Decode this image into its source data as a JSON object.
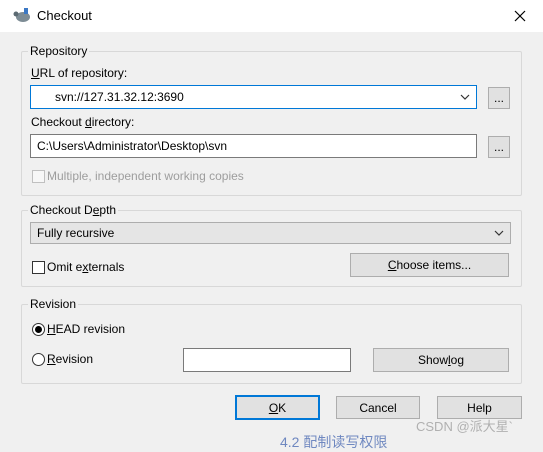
{
  "window": {
    "title": "Checkout",
    "close_icon": "close-icon",
    "app_icon": "svn-turtle-icon"
  },
  "repository": {
    "group_label": "Repository",
    "url_label": "URL of repository:",
    "url_value": "svn://127.31.32.12:3690",
    "browse_label": "...",
    "dir_label": "Checkout directory:",
    "dir_value": "C:\\Users\\Administrator\\Desktop\\svn",
    "browse_dir_label": "...",
    "multiple_label": "Multiple, independent working copies",
    "multiple_checked": false
  },
  "depth": {
    "group_label": "Checkout Depth",
    "selected": "Fully recursive",
    "omit_externals_label": "Omit externals",
    "omit_externals_checked": false,
    "choose_items_label": "Choose items..."
  },
  "revision": {
    "group_label": "Revision",
    "head_label": "HEAD revision",
    "head_selected": true,
    "revision_label": "Revision",
    "revision_value": "",
    "show_log_label": "Show log"
  },
  "buttons": {
    "ok": "OK",
    "cancel": "Cancel",
    "help": "Help"
  },
  "overlay": {
    "watermark": "CSDN @派大星`",
    "bottom_text": "4.2 配制读写权限"
  },
  "colors": {
    "focus": "#0078d7",
    "background": "#f0f0f0"
  }
}
